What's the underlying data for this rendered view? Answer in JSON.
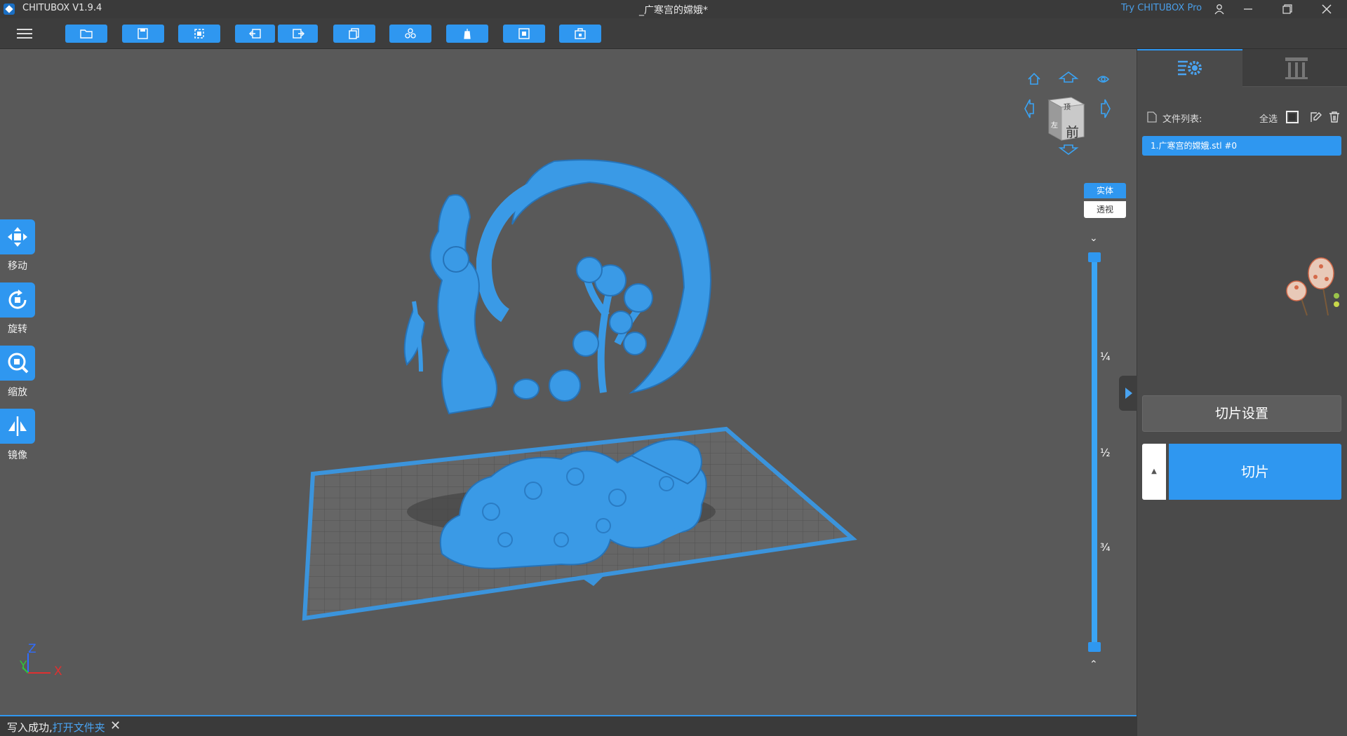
{
  "app": {
    "name": "CHITUBOX V1.9.4",
    "document_title": "_广寒宫的嫦娥*",
    "pro_link": "Try CHITUBOX Pro"
  },
  "window_controls": [
    "user-icon",
    "minimize-icon",
    "restore-icon",
    "close-icon"
  ],
  "toolbar": {
    "buttons": [
      "open-file-icon",
      "save-icon",
      "auto-layout-icon",
      "undo-icon",
      "redo-icon",
      "copy-icon",
      "multi-icon",
      "support-icon",
      "hollow-icon",
      "dig-hole-icon"
    ]
  },
  "tools": [
    {
      "label": "移动",
      "icon": "move-icon"
    },
    {
      "label": "旋转",
      "icon": "rotate-icon"
    },
    {
      "label": "缩放",
      "icon": "scale-icon"
    },
    {
      "label": "镜像",
      "icon": "mirror-icon"
    }
  ],
  "axes": {
    "z": "Z",
    "y": "Y",
    "x": "X"
  },
  "view_cube": {
    "front_label": "前",
    "top_label": "顶",
    "left_label": "左",
    "mode_solid": "实体",
    "mode_perspective": "透视"
  },
  "layer_slider": {
    "marks": [
      "¼",
      "½",
      "¾"
    ]
  },
  "status": {
    "message": "写入成功,",
    "link": "打开文件夹",
    "close": "✕"
  },
  "panel": {
    "file_list_label": "文件列表:",
    "select_all": "全选",
    "files": [
      "1.广寒宫的嫦娥.stl #0"
    ],
    "slice_settings": "切片设置",
    "slice": "切片",
    "slice_arrow": "▲"
  },
  "colors": {
    "accent": "#2f97f0",
    "model": "#3a9ae6",
    "background": "#595959"
  }
}
